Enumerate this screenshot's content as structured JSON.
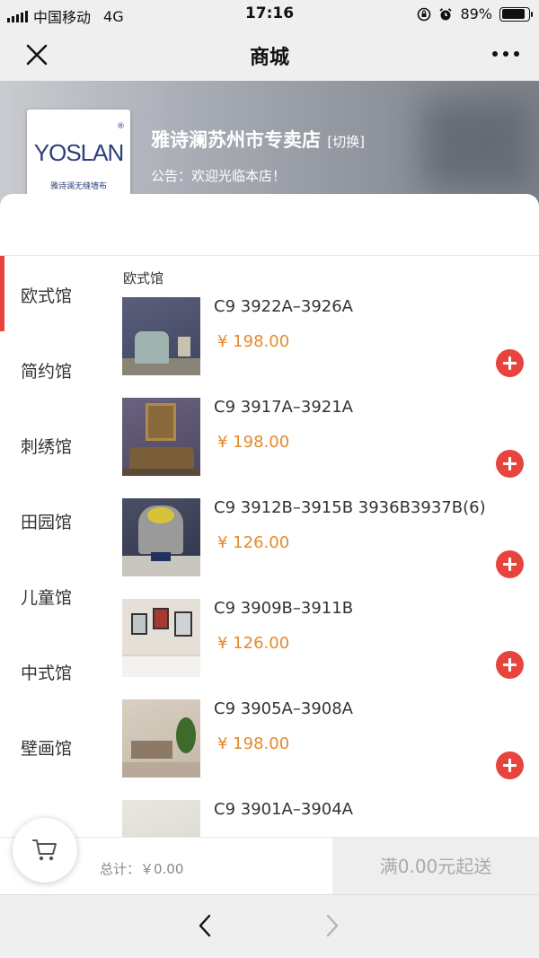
{
  "status_bar": {
    "carrier": "中国移动",
    "network": "4G",
    "time": "17:16",
    "battery": "89%",
    "battery_level": 0.89
  },
  "nav_bar": {
    "title": "商城"
  },
  "store": {
    "logo_text": "YOSLAN",
    "logo_mark": "®",
    "logo_subtext": "雅诗澜无缝墙布",
    "name": "雅诗澜苏州市专卖店",
    "switch_label": "[切换]",
    "notice": "公告：欢迎光临本店！"
  },
  "categories": [
    {
      "label": "欧式馆",
      "active": true
    },
    {
      "label": "简约馆",
      "active": false
    },
    {
      "label": "刺绣馆",
      "active": false
    },
    {
      "label": "田园馆",
      "active": false
    },
    {
      "label": "儿童馆",
      "active": false
    },
    {
      "label": "中式馆",
      "active": false
    },
    {
      "label": "壁画馆",
      "active": false
    }
  ],
  "section_title": "欧式馆",
  "products": [
    {
      "name": "C9 3922A–3926A",
      "price": "¥ 198.00"
    },
    {
      "name": "C9 3917A–3921A",
      "price": "¥ 198.00"
    },
    {
      "name": "C9 3912B–3915B 3936B3937B(6)",
      "price": "¥ 126.00"
    },
    {
      "name": "C9 3909B–3911B",
      "price": "¥ 126.00"
    },
    {
      "name": "C9 3905A–3908A",
      "price": "¥ 198.00"
    },
    {
      "name": "C9 3901A–3904A",
      "price": ""
    }
  ],
  "cart": {
    "total_label": "总计：￥0.00",
    "checkout_label": "满0.00元起送"
  },
  "colors": {
    "accent": "#e8443e",
    "price": "#e48a2c"
  },
  "icons": {
    "close": "close-icon",
    "more": "more-icon",
    "cart": "cart-icon",
    "add": "plus-icon",
    "back": "chevron-left-icon",
    "forward": "chevron-right-icon"
  }
}
